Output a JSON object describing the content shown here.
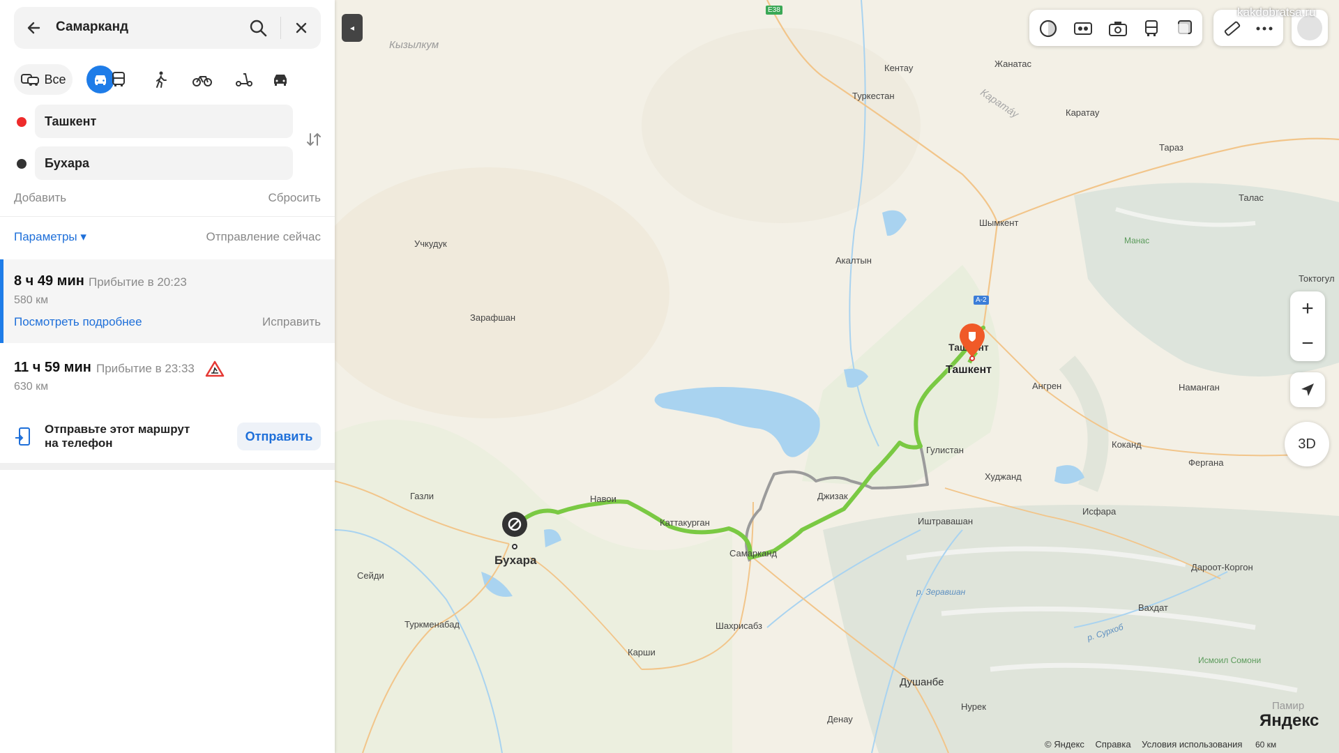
{
  "search": {
    "query": "Самарканд"
  },
  "modes": {
    "all_label": "Все"
  },
  "route_points": {
    "from": "Ташкент",
    "to": "Бухара"
  },
  "actions": {
    "add": "Добавить",
    "reset": "Сбросить"
  },
  "params": {
    "label": "Параметры ▾",
    "departure": "Отправление сейчас"
  },
  "routes": [
    {
      "duration": "8 ч 49 мин",
      "arrival": "Прибытие в 20:23",
      "distance": "580 км",
      "details": "Посмотреть подробнее",
      "fix": "Исправить"
    },
    {
      "duration": "11 ч 59 мин",
      "arrival": "Прибытие в 23:33",
      "distance": "630 км"
    }
  ],
  "send": {
    "text": "Отправьте этот маршрут на телефон",
    "button": "Отправить"
  },
  "map": {
    "labels": [
      "Кызылкум",
      "Кентау",
      "Жанатас",
      "Туркестан",
      "Каратау",
      "Карата́у",
      "Тараз",
      "Талас",
      "Шымкент",
      "Манас",
      "Учкудук",
      "Акалтын",
      "Токтогул",
      "Зарафшан",
      "Ташкент",
      "Ангрен",
      "Наманган",
      "Гулистан",
      "Коканд",
      "Фергана",
      "Худжанд",
      "Джизак",
      "Газли",
      "Навои",
      "Каттакурган",
      "Исфара",
      "Иштравашан",
      "Бухара",
      "Самарканд",
      "Сейди",
      "р. Зеравшан",
      "Дароот-Коргон",
      "Туркменабад",
      "Вахдат",
      "Шахрисабз",
      "р. Сурхоб",
      "Карши",
      "Исмоил Сомони",
      "Душанбе",
      "Нурек",
      "Памир",
      "Денау",
      "E38",
      "A-2"
    ],
    "origin_label": "Ташкент",
    "destination_label": "Бухара"
  },
  "map_controls": {
    "zoom_in": "+",
    "zoom_out": "−",
    "three_d": "3D"
  },
  "footer": {
    "copyright": "© Яндекс",
    "help": "Справка",
    "terms": "Условия использования",
    "scale": "60 км"
  },
  "brand": "Яндекс",
  "watermark": "kakdobratsa.ru"
}
